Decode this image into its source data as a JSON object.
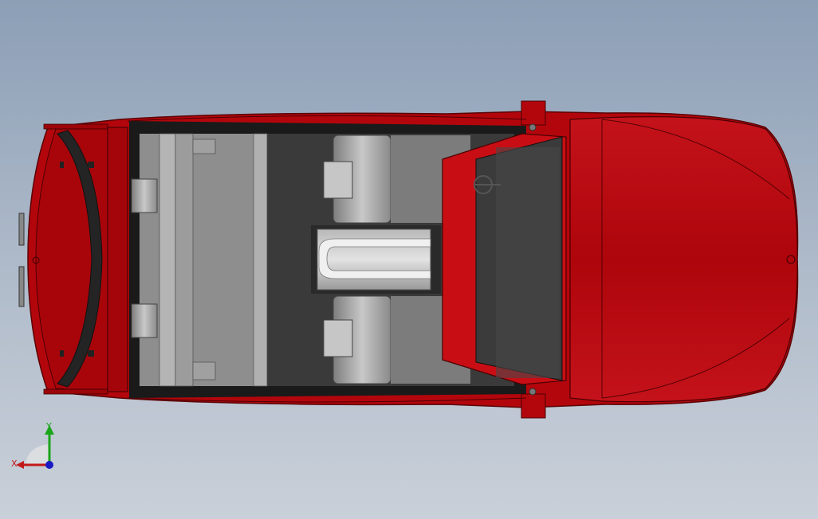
{
  "viewport": {
    "background_top": "#8c9fb6",
    "background_bottom": "#c9d0d9"
  },
  "model": {
    "body_color": "#b3060c",
    "body_dark_color": "#7e0005",
    "interior_dark": "#2a2a2a",
    "interior_floor": "#3d3d3d",
    "seat_color": "#a8a8a8",
    "windshield_color": "#3b3b3b"
  },
  "triad": {
    "x_label": "X",
    "y_label": "Y",
    "x_color": "#c21a1a",
    "y_color": "#1aa51a",
    "z_color": "#1a1ac2"
  }
}
